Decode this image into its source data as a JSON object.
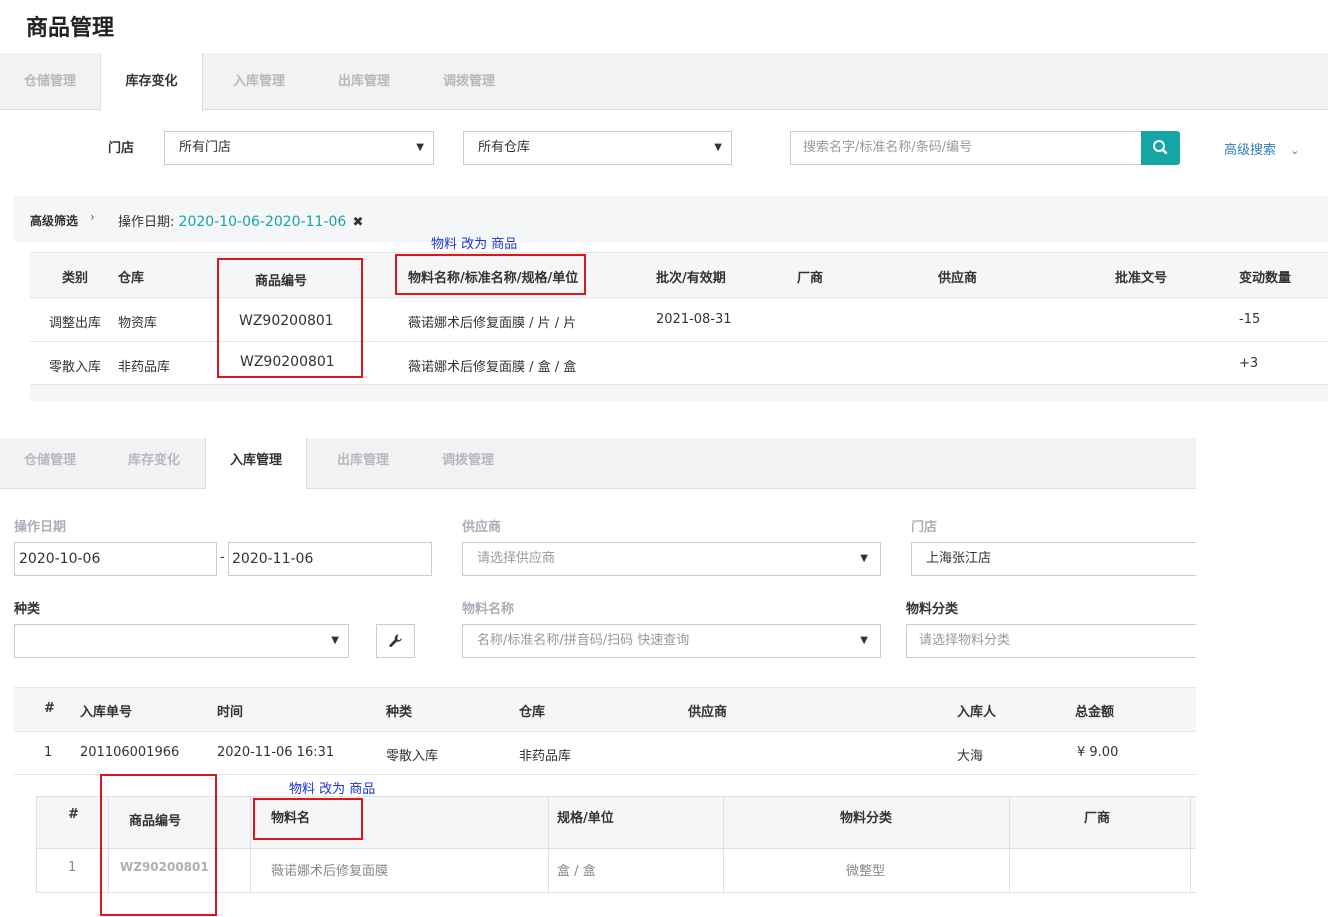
{
  "page_title": "商品管理",
  "top_tabs": [
    {
      "label": "仓储管理",
      "active": false
    },
    {
      "label": "库存变化",
      "active": true
    },
    {
      "label": "入库管理",
      "active": false
    },
    {
      "label": "出库管理",
      "active": false
    },
    {
      "label": "调拨管理",
      "active": false
    }
  ],
  "filters": {
    "store_label": "门店",
    "store_value": "所有门店",
    "warehouse_value": "所有仓库",
    "search_placeholder": "搜索名字/标准名称/条码/编号",
    "advanced_search": "高级搜索"
  },
  "advanced_filter": {
    "label": "高级筛选",
    "chip_key": "操作日期:",
    "chip_value": "2020-10-06-2020-11-06"
  },
  "annotation_1": "物料 改为 商品",
  "inventory_table": {
    "headers": [
      "类别",
      "仓库",
      "商品编号",
      "物料名称/标准名称/规格/单位",
      "批次/有效期",
      "厂商",
      "供应商",
      "批准文号",
      "变动数量"
    ],
    "rows": [
      [
        "调整出库",
        "物资库",
        "WZ90200801",
        "薇诺娜术后修复面膜 / 片 / 片",
        "2021-08-31",
        "",
        "",
        "",
        "-15"
      ],
      [
        "零散入库",
        "非药品库",
        "WZ90200801",
        "薇诺娜术后修复面膜 / 盒 / 盒",
        "",
        "",
        "",
        "",
        "+3"
      ]
    ]
  },
  "bottom_tabs": [
    {
      "label": "仓储管理",
      "active": false
    },
    {
      "label": "库存变化",
      "active": false
    },
    {
      "label": "入库管理",
      "active": true
    },
    {
      "label": "出库管理",
      "active": false
    },
    {
      "label": "调拨管理",
      "active": false
    }
  ],
  "inbound_form": {
    "date_label": "操作日期",
    "date_from": "2020-10-06",
    "date_sep": "-",
    "date_to": "2020-11-06",
    "supplier_label": "供应商",
    "supplier_placeholder": "请选择供应商",
    "store_label": "门店",
    "store_value": "上海张江店",
    "kind_label": "种类",
    "kind_value": "",
    "material_label": "物料名称",
    "material_placeholder": "名称/标准名称/拼音码/扫码 快速查询",
    "category_label": "物料分类",
    "category_placeholder": "请选择物料分类"
  },
  "inbound_table": {
    "headers": [
      "#",
      "入库单号",
      "时间",
      "种类",
      "仓库",
      "供应商",
      "入库人",
      "总金额"
    ],
    "rows": [
      [
        "1",
        "201106001966",
        "2020-11-06 16:31",
        "零散入库",
        "非药品库",
        "",
        "大海",
        "¥ 9.00"
      ]
    ]
  },
  "annotation_2": "物料 改为 商品",
  "detail_table": {
    "headers": [
      "#",
      "商品编号",
      "物料名",
      "规格/单位",
      "物料分类",
      "厂商"
    ],
    "rows": [
      [
        "1",
        "WZ90200801",
        "薇诺娜术后修复面膜",
        "盒 / 盒",
        "微整型",
        ""
      ]
    ]
  },
  "colors": {
    "accent": "#16a5a5",
    "link": "#2a7fc0",
    "annotation": "#1a33d6",
    "highlight": "#e0141e"
  }
}
